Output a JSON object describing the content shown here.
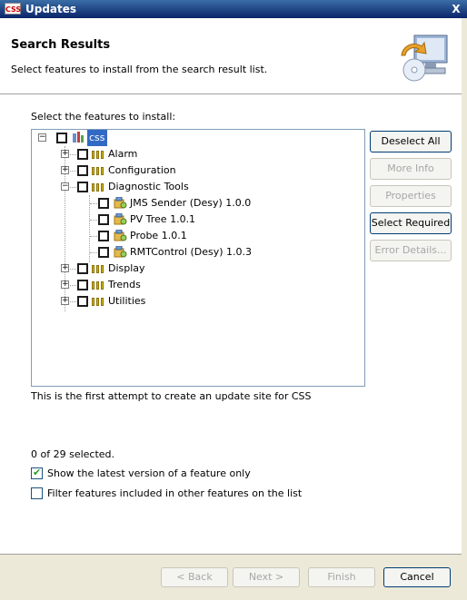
{
  "window": {
    "title": "Updates",
    "app_icon_text": "CSS",
    "close_glyph": "X"
  },
  "header": {
    "title": "Search Results",
    "description": "Select features to install from the search result list.",
    "icon": "update-computer-icon"
  },
  "main": {
    "select_label": "Select the features to install:",
    "tree": {
      "root": {
        "label": "css",
        "expander": "−",
        "checked": false,
        "selected": true
      },
      "items": [
        {
          "label": "Alarm",
          "expander": "+",
          "checked": false,
          "type": "category"
        },
        {
          "label": "Configuration",
          "expander": "+",
          "checked": false,
          "type": "category"
        },
        {
          "label": "Diagnostic Tools",
          "expander": "−",
          "checked": false,
          "type": "category",
          "children": [
            {
              "label": "JMS Sender (Desy) 1.0.0",
              "checked": false
            },
            {
              "label": "PV Tree 1.0.1",
              "checked": false
            },
            {
              "label": "Probe 1.0.1",
              "checked": false
            },
            {
              "label": "RMTControl (Desy) 1.0.3",
              "checked": false
            }
          ]
        },
        {
          "label": "Display",
          "expander": "+",
          "checked": false,
          "type": "category"
        },
        {
          "label": "Trends",
          "expander": "+",
          "checked": false,
          "type": "category"
        },
        {
          "label": "Utilities",
          "expander": "+",
          "checked": false,
          "type": "category"
        }
      ]
    },
    "buttons": {
      "deselect_all": "Deselect All",
      "more_info": "More Info",
      "properties": "Properties",
      "select_required": "Select Required",
      "error_details": "Error Details..."
    },
    "description_text": "This is the first attempt to create an update site for CSS",
    "selection_count": "0 of 29 selected.",
    "options": {
      "show_latest": {
        "label": "Show the latest version of a feature only",
        "checked": true
      },
      "filter_included": {
        "label": "Filter features included in other features on the list",
        "checked": false
      }
    }
  },
  "footer": {
    "back": "< Back",
    "next": "Next >",
    "finish": "Finish",
    "cancel": "Cancel"
  },
  "colors": {
    "titlebar": "#0a246a",
    "selection": "#316ac5",
    "footer_bg": "#ece9d8",
    "category_icon": "#d6b600"
  }
}
